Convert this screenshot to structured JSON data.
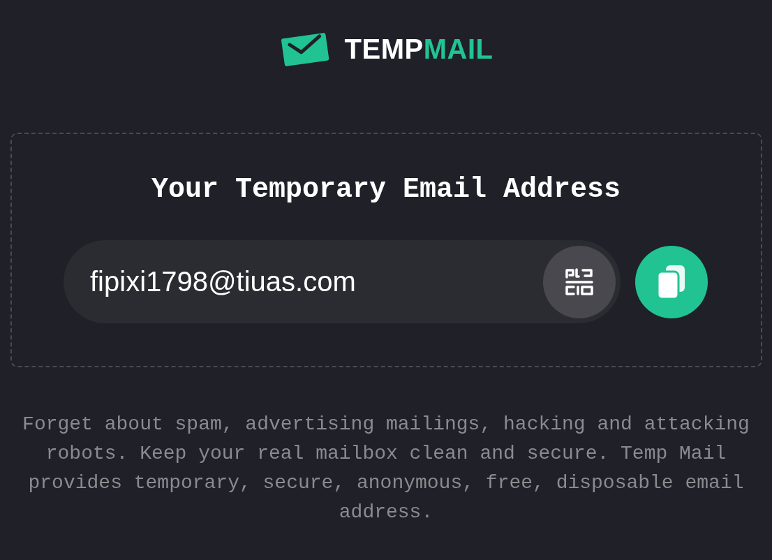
{
  "logo": {
    "parts": [
      {
        "text": "TEMP",
        "color": "#ffffff"
      },
      {
        "text": "MAIL",
        "color": "#21c393"
      }
    ]
  },
  "address_panel": {
    "title": "Your Temporary Email Address",
    "email_field": {
      "value": "fipixi1798@tiuas.com"
    }
  },
  "description": "Forget about spam, advertising mailings, hacking and attacking robots. Keep your real mailbox clean and secure. Temp Mail provides temporary, secure, anonymous, free, disposable email address."
}
